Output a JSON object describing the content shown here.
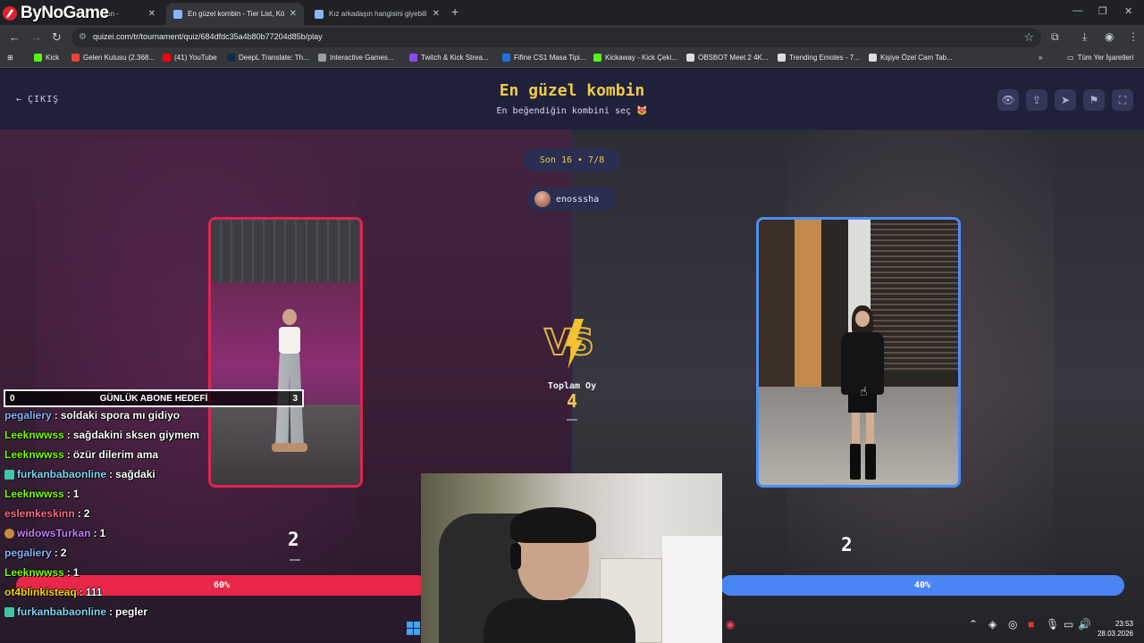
{
  "browser": {
    "brand_overlay": "ByNoGame",
    "tabs": [
      {
        "label": "...dan - ",
        "active": false
      },
      {
        "label": "En güzel kombin - Tier List, Kör...",
        "active": true
      },
      {
        "label": "Kız arkadaşın hangisini giyebili...",
        "active": false
      }
    ],
    "url": "quizei.com/tr/tournament/quiz/684dfdc35a4b80b77204d85b/play",
    "bookmarks": [
      {
        "label": "Kick",
        "color": "#53fc18"
      },
      {
        "label": "Gelen Kutusu (2.368...",
        "color": "#ea4335"
      },
      {
        "label": "(41) YouTube",
        "color": "#ff0000"
      },
      {
        "label": "DeepL Translate: Th...",
        "color": "#0f2b46"
      },
      {
        "label": "Interactive Games...",
        "color": "#9aa0a6"
      },
      {
        "label": "Twitch & Kick Strea...",
        "color": "#9146ff"
      },
      {
        "label": "Fifine CS1 Masa Tipi...",
        "color": "#1a73e8"
      },
      {
        "label": "Kickaway - Kick Çeki...",
        "color": "#53fc18"
      },
      {
        "label": "OBSBOT Meet 2 4K...",
        "color": "#ffffff"
      },
      {
        "label": "Trending Emotes - 7...",
        "color": "#ffffff"
      },
      {
        "label": "Kişiye Özel Cam Tab...",
        "color": "#ffffff"
      }
    ],
    "all_bookmarks": "Tüm Yer İşaretleri"
  },
  "header": {
    "exit_label": "ÇIKIŞ",
    "title": "En güzel kombin",
    "subtitle": "En beğendiğin kombini seç 😻"
  },
  "round": {
    "label": "Son 16 • 7/8",
    "username": "enosssha"
  },
  "vs": {
    "total_label": "Toplam Oy",
    "total_value": "4"
  },
  "left_option": {
    "votes": "2",
    "percent_label": "60%",
    "accent": "#e0244f"
  },
  "right_option": {
    "votes": "2",
    "percent_label": "40%",
    "accent": "#4e8df5"
  },
  "stream_overlay": {
    "goal": {
      "min": "0",
      "label": "GÜNLÜK ABONE HEDEFİ",
      "max": "3"
    },
    "chat": [
      {
        "user": "pegaliery",
        "msg": "soldaki spora mı gidiyo",
        "color": "#8ab4f8",
        "badge": ""
      },
      {
        "user": "Leeknwwss",
        "msg": "sağdakini sksen giymem",
        "color": "#7CFC00",
        "badge": ""
      },
      {
        "user": "Leeknwwss",
        "msg": "özür dilerim ama",
        "color": "#7CFC00",
        "badge": ""
      },
      {
        "user": "furkanbabaonline",
        "msg": "sağdaki",
        "color": "#7fd6f5",
        "badge": "#3ec7a8"
      },
      {
        "user": "Leeknwwss",
        "msg": "1",
        "color": "#7CFC00",
        "badge": ""
      },
      {
        "user": "eslemkeskinn",
        "msg": "2",
        "color": "#ff6b8a",
        "badge": ""
      },
      {
        "user": "widowsTurkan",
        "msg": "1",
        "color": "#c77dff",
        "badge": "#c98b3a"
      },
      {
        "user": "pegaliery",
        "msg": "2",
        "color": "#8ab4f8",
        "badge": ""
      },
      {
        "user": "Leeknwwss",
        "msg": "1",
        "color": "#7CFC00",
        "badge": ""
      },
      {
        "user": "ot4blinkisteaq",
        "msg": "111",
        "color": "#f5d90a",
        "badge": ""
      },
      {
        "user": "furkanbabaonline",
        "msg": "pegler",
        "color": "#7fd6f5",
        "badge": "#3ec7a8"
      }
    ]
  },
  "taskbar": {
    "time": "23:53",
    "date": "28.03.2026"
  }
}
